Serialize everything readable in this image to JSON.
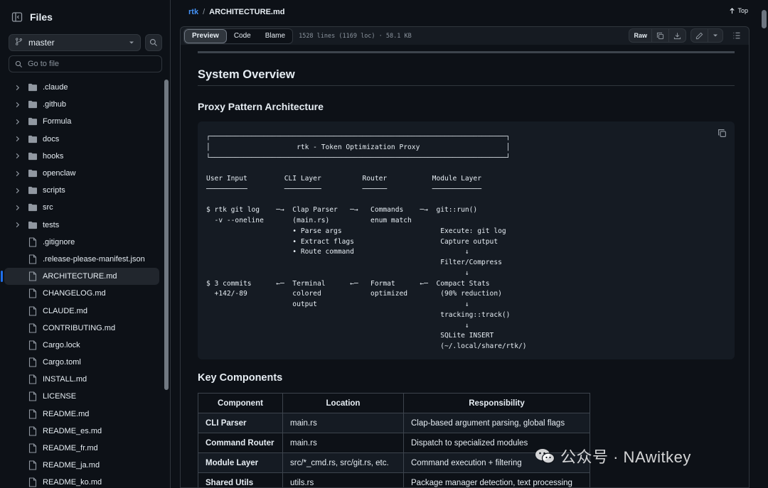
{
  "sidebar": {
    "title": "Files",
    "branch": "master",
    "goto_placeholder": "Go to file",
    "folders": [
      ".claude",
      ".github",
      "Formula",
      "docs",
      "hooks",
      "openclaw",
      "scripts",
      "src",
      "tests"
    ],
    "files": [
      ".gitignore",
      ".release-please-manifest.json",
      "ARCHITECTURE.md",
      "CHANGELOG.md",
      "CLAUDE.md",
      "CONTRIBUTING.md",
      "Cargo.lock",
      "Cargo.toml",
      "INSTALL.md",
      "LICENSE",
      "README.md",
      "README_es.md",
      "README_fr.md",
      "README_ja.md",
      "README_ko.md"
    ],
    "active_file": "ARCHITECTURE.md"
  },
  "breadcrumb": {
    "repo": "rtk",
    "sep": "/",
    "file": "ARCHITECTURE.md"
  },
  "top_link": "Top",
  "filebar": {
    "tabs": [
      "Preview",
      "Code",
      "Blame"
    ],
    "active_tab": "Preview",
    "meta": "1528 lines (1169 loc) · 58.1 KB",
    "raw_label": "Raw"
  },
  "doc": {
    "h2_system": "System Overview",
    "h3_proxy": "Proxy Pattern Architecture",
    "diagram": "┌────────────────────────────────────────────────────────────────────────┐\n│                     rtk - Token Optimization Proxy                     │\n└────────────────────────────────────────────────────────────────────────┘\n\nUser Input         CLI Layer          Router           Module Layer\n──────────         ─────────          ──────           ────────────\n\n$ rtk git log    ─→  Clap Parser   ─→   Commands    ─→  git::run()\n  -v --oneline       (main.rs)          enum match\n                     • Parse args                        Execute: git log\n                     • Extract flags                     Capture output\n                     • Route command                           ↓\n                                                         Filter/Compress\n                                                               ↓\n$ 3 commits      ←─  Terminal      ←─   Format      ←─  Compact Stats\n  +142/-89           colored            optimized        (90% reduction)\n                     output                                    ↓\n                                                         tracking::track()\n                                                               ↓\n                                                         SQLite INSERT\n                                                         (~/.local/share/rtk/)",
    "h2_key": "Key Components",
    "table_headers": [
      "Component",
      "Location",
      "Responsibility"
    ],
    "table_rows": [
      [
        "CLI Parser",
        "main.rs",
        "Clap-based argument parsing, global flags"
      ],
      [
        "Command Router",
        "main.rs",
        "Dispatch to specialized modules"
      ],
      [
        "Module Layer",
        "src/*_cmd.rs, src/git.rs, etc.",
        "Command execution + filtering"
      ],
      [
        "Shared Utils",
        "utils.rs",
        "Package manager detection, text processing"
      ]
    ]
  },
  "watermark": "公众号 · NAwitkey",
  "colors": {
    "accent": "#4493f8",
    "background": "#0d1117",
    "border": "#30363d"
  }
}
